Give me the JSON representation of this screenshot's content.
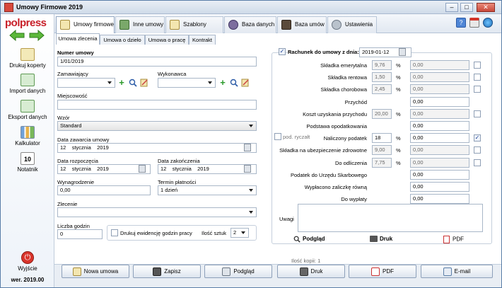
{
  "window": {
    "title": "Umowy Firmowe 2019"
  },
  "sidebar": {
    "logo": "polpress",
    "items": [
      {
        "label": "Drukuj koperty"
      },
      {
        "label": "Import danych"
      },
      {
        "label": "Eksport danych"
      },
      {
        "label": "Kalkulator"
      },
      {
        "label": "Notatnik",
        "badge": "10"
      }
    ],
    "exit_label": "Wyjście",
    "version": "wer. 2019.00"
  },
  "top_tabs": [
    {
      "label": "Umowy firmowe"
    },
    {
      "label": "Inne umowy"
    },
    {
      "label": "Szablony umów"
    },
    {
      "label": "Baza danych"
    },
    {
      "label": "Baza umów"
    },
    {
      "label": "Ustawienia"
    }
  ],
  "sub_tabs": [
    {
      "label": "Umowa zlecenia"
    },
    {
      "label": "Umowa o dzieło"
    },
    {
      "label": "Umowa o pracę"
    },
    {
      "label": "Kontrakt"
    }
  ],
  "form": {
    "numer_label": "Numer umowy",
    "numer_value": "1/01/2019",
    "zamawiajacy_label": "Zamawiający",
    "zamawiajacy_value": "",
    "wykonawca_label": "Wykonawca",
    "wykonawca_value": "",
    "miejscowosc_label": "Miejscowość",
    "miejscowosc_value": "",
    "wzor_label": "Wzór",
    "wzor_value": "Standard",
    "data_zawarcia_label": "Data zawarcia umowy",
    "data_zawarcia": {
      "day": "12",
      "month": "stycznia",
      "year": "2019"
    },
    "data_rozpoczecia_label": "Data rozpoczęcia",
    "data_rozpoczecia": {
      "day": "12",
      "month": "stycznia",
      "year": "2019"
    },
    "data_zakonczenia_label": "Data zakończenia",
    "data_zakonczenia": {
      "day": "12",
      "month": "stycznia",
      "year": "2019"
    },
    "wynagrodzenie_label": "Wynagrodzenie",
    "wynagrodzenie_value": "0,00",
    "termin_label": "Termin płatności",
    "termin_value": "1 dzień",
    "zlecenie_label": "Zlecenie",
    "zlecenie_value": "",
    "liczba_godzin_label": "Liczba godzin",
    "liczba_godzin_value": "0",
    "drukuj_ewidencje_label": "Drukuj ewidencję godzin pracy",
    "ilosc_sztuk_label": "Ilość sztuk",
    "ilosc_sztuk_value": "2"
  },
  "rachunek": {
    "checkbox_label": "Rachunek do umowy z dnia:",
    "date": "2019-01-12",
    "rows": [
      {
        "label": "Składka emerytalna",
        "pct": "9,76",
        "value": "0,00"
      },
      {
        "label": "Składka rentowa",
        "pct": "1,50",
        "value": "0,00"
      },
      {
        "label": "Składka chorobowa",
        "pct": "2,45",
        "value": "0,00"
      },
      {
        "label": "Przychód",
        "value": "0,00"
      },
      {
        "label": "Koszt uzyskania przychodu",
        "pct": "20,00",
        "value": "0,00"
      },
      {
        "label": "Podstawa opodatkowania",
        "value": "0,00"
      },
      {
        "label": "Naliczony podatek",
        "pct": "18",
        "value": "0,00"
      },
      {
        "label": "Składka na ubezpieczenie zdrowotne",
        "pct": "9,00",
        "value": "0,00"
      },
      {
        "label": "Do odliczenia",
        "pct": "7,75",
        "value": "0,00"
      },
      {
        "label": "Podatek do Urzędu Skarbowego",
        "value": "0,00"
      },
      {
        "label": "Wypłacono zaliczkę równą",
        "value": "0,00"
      },
      {
        "label": "Do wypłaty",
        "value": "0,00"
      }
    ],
    "pod_ryczalt_label": "pod. ryczałt",
    "pct_sign": "%",
    "uwagi_label": "Uwagi",
    "podglad_label": "Podgląd",
    "druk_label": "Druk",
    "pdf_label": "PDF"
  },
  "copies_label": "Ilość kopii: 1",
  "bottom_buttons": [
    {
      "label": "Nowa umowa"
    },
    {
      "label": "Zapisz"
    },
    {
      "label": "Podgląd"
    },
    {
      "label": "Druk"
    },
    {
      "label": "PDF"
    },
    {
      "label": "E-mail"
    }
  ]
}
